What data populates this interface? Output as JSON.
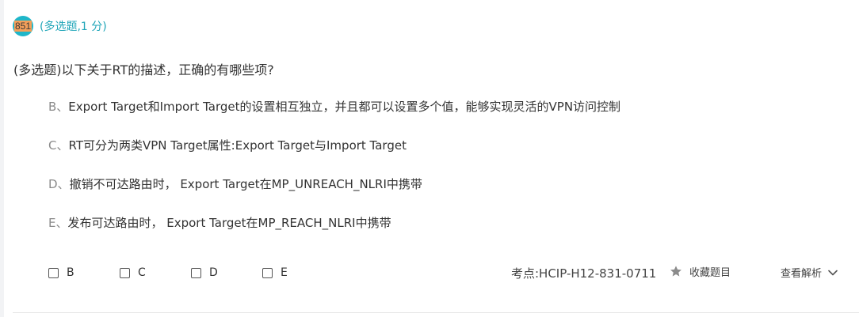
{
  "question": {
    "number": "851",
    "type_label": "(多选题,1 分)",
    "stem": "(多选题)以下关于RT的描述，正确的有哪些项?",
    "options": [
      {
        "key": "B、",
        "text": "Export Target和Import Target的设置相互独立，并且都可以设置多个值，能够实现灵活的VPN访问控制"
      },
      {
        "key": "C、",
        "text": "RT可分为两类VPN Target属性:Export Target与Import Target"
      },
      {
        "key": "D、",
        "text": "撤销不可达路由时， Export Target在MP_UNREACH_NLRI中携带"
      },
      {
        "key": "E、",
        "text": "发布可达路由时， Export Target在MP_REACH_NLRI中携带"
      }
    ]
  },
  "answers": [
    {
      "label": "B",
      "checked": false
    },
    {
      "label": "C",
      "checked": false
    },
    {
      "label": "D",
      "checked": false
    },
    {
      "label": "E",
      "checked": false
    }
  ],
  "footer": {
    "kaodian": "考点:HCIP-H12-831-0711",
    "favorite_label": "收藏题目",
    "view_analysis_label": "查看解析"
  },
  "colors": {
    "accent": "#1fa5b8",
    "badge_bg": "#1fb6c9",
    "badge_highlight": "#f5a05a"
  },
  "icons": {
    "favorite": "star-icon",
    "expand": "chevron-down-icon"
  }
}
